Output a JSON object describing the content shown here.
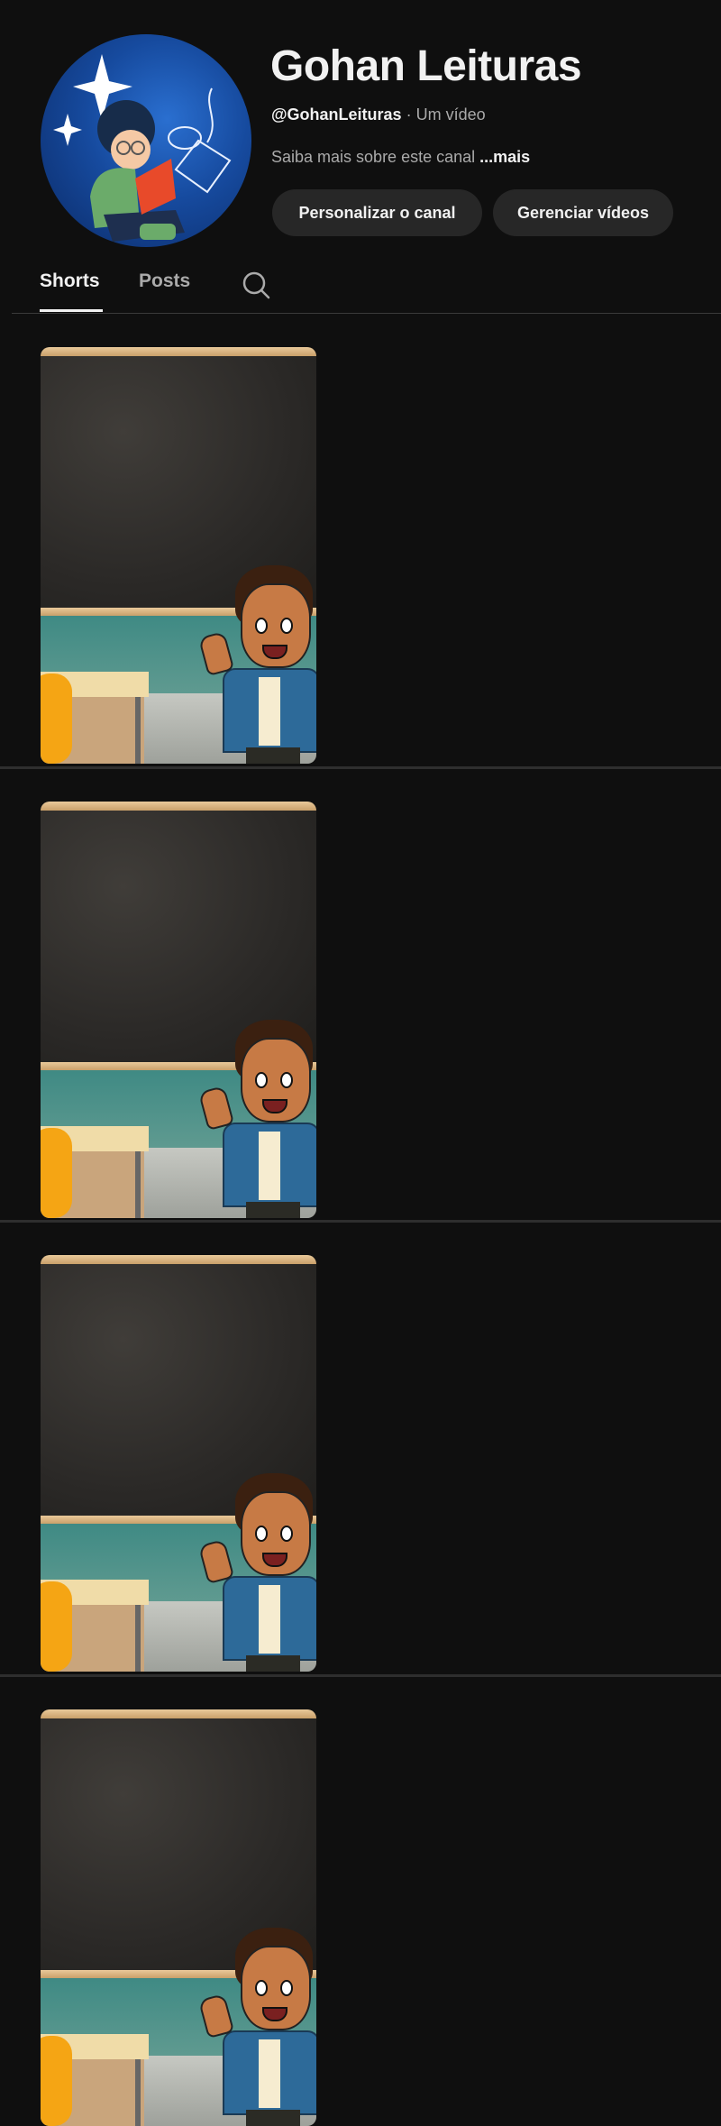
{
  "channel": {
    "name": "Gohan Leituras",
    "handle": "@GohanLeituras",
    "video_count": "· Um vídeo",
    "description": "Saiba mais sobre este canal",
    "more_link": "...mais",
    "avatar_icon": "boy-reading-book-avatar"
  },
  "actions": {
    "customize": "Personalizar o canal",
    "manage": "Gerenciar vídeos"
  },
  "tabs": [
    {
      "label": "Shorts",
      "active": true
    },
    {
      "label": "Posts",
      "active": false
    }
  ],
  "search_icon": "search-icon",
  "shorts": [
    {
      "thumbnail": "classroom-boy-waving"
    },
    {
      "thumbnail": "classroom-boy-waving"
    },
    {
      "thumbnail": "classroom-boy-waving"
    },
    {
      "thumbnail": "classroom-chalkboard"
    }
  ],
  "colors": {
    "background": "#0f0f0f",
    "button": "#272727",
    "text": "#f1f1f1",
    "secondary_text": "#aaaaaa"
  }
}
